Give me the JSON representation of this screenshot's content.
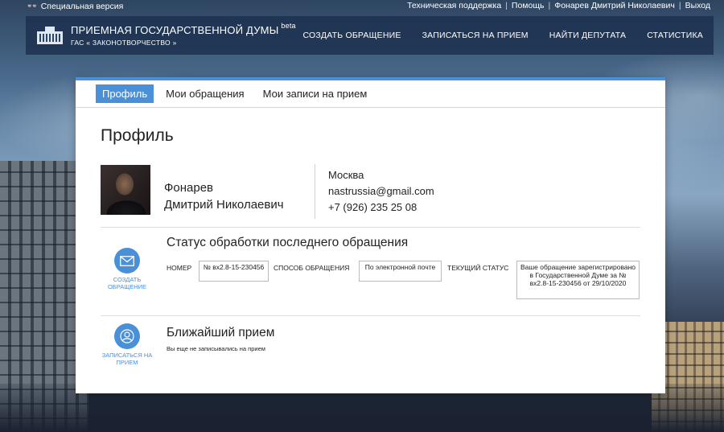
{
  "topbar": {
    "special_version": "Специальная версия",
    "links": [
      "Техническая поддержка",
      "Помощь",
      "Фонарев Дмитрий Николаевич",
      "Выход"
    ]
  },
  "navbar": {
    "logo_title": "ПРИЕМНАЯ ГОСУДАРСТВЕННОЙ ДУМЫ",
    "logo_beta": "beta",
    "logo_sub": "ГАС « ЗАКОНОТВОРЧЕСТВО »",
    "menu": [
      "СОЗДАТЬ ОБРАЩЕНИЕ",
      "ЗАПИСАТЬСЯ НА ПРИЕМ",
      "НАЙТИ ДЕПУТАТА",
      "СТАТИСТИКА"
    ]
  },
  "tabs": [
    "Профиль",
    "Мои обращения",
    "Мои записи на прием"
  ],
  "profile": {
    "title": "Профиль",
    "last_name": "Фонарев",
    "first_middle": "Дмитрий Николаевич",
    "city": "Москва",
    "email": "nastrussia@gmail.com",
    "phone": "+7 (926) 235 25 08"
  },
  "status_section": {
    "title": "Статус обработки последнего обращения",
    "action_label": "СОЗДАТЬ ОБРАЩЕНИЕ",
    "number_label": "НОМЕР",
    "number_value": "№ вх2.8-15-230456",
    "method_label": "СПОСОБ ОБРАЩЕНИЯ",
    "method_value": "По электронной почте",
    "status_label": "ТЕКУЩИЙ СТАТУС",
    "status_value": "Ваше обращение зарегистрировано в Государственной Думе за № вх2.8-15-230456 от 29/10/2020"
  },
  "reception_section": {
    "title": "Ближайший прием",
    "action_label": "ЗАПИСАТЬСЯ НА ПРИЕМ",
    "empty_text": "Вы еще не записывались на прием"
  },
  "colors": {
    "accent": "#4a90d9",
    "navbar_bg": "#1c304e"
  }
}
